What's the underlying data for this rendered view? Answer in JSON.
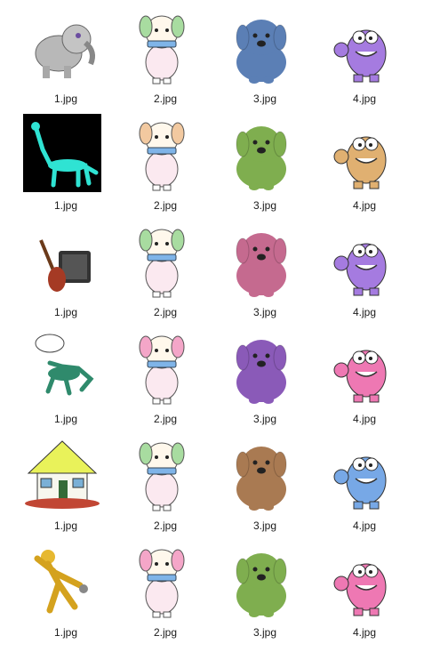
{
  "explorer": {
    "items": [
      {
        "label": "1.jpg",
        "icon": "elephant-thumbnail",
        "bg": "#ffffff"
      },
      {
        "label": "2.jpg",
        "icon": "dog-harmonica-green-thumbnail",
        "bg": "#ffffff"
      },
      {
        "label": "3.jpg",
        "icon": "puppy-blue-thumbnail",
        "bg": "#ffffff"
      },
      {
        "label": "4.jpg",
        "icon": "monster-purple-thumbnail",
        "bg": "#ffffff"
      },
      {
        "label": "1.jpg",
        "icon": "giraffe-thumbnail",
        "bg": "#000000"
      },
      {
        "label": "2.jpg",
        "icon": "dog-harmonica-orange-thumbnail",
        "bg": "#ffffff"
      },
      {
        "label": "3.jpg",
        "icon": "puppy-green-thumbnail",
        "bg": "#ffffff"
      },
      {
        "label": "4.jpg",
        "icon": "monster-orange-thumbnail",
        "bg": "#ffffff"
      },
      {
        "label": "1.jpg",
        "icon": "guitar-amp-thumbnail",
        "bg": "#ffffff"
      },
      {
        "label": "2.jpg",
        "icon": "dog-harmonica-green-thumbnail",
        "bg": "#ffffff"
      },
      {
        "label": "3.jpg",
        "icon": "puppy-pink-thumbnail",
        "bg": "#ffffff"
      },
      {
        "label": "4.jpg",
        "icon": "monster-purple-thumbnail",
        "bg": "#ffffff"
      },
      {
        "label": "1.jpg",
        "icon": "horse-thumbnail",
        "bg": "#ffffff"
      },
      {
        "label": "2.jpg",
        "icon": "dog-harmonica-pink-thumbnail",
        "bg": "#ffffff"
      },
      {
        "label": "3.jpg",
        "icon": "puppy-purple-thumbnail",
        "bg": "#ffffff"
      },
      {
        "label": "4.jpg",
        "icon": "monster-pink-thumbnail",
        "bg": "#ffffff"
      },
      {
        "label": "1.jpg",
        "icon": "house-thumbnail",
        "bg": "#ffffff"
      },
      {
        "label": "2.jpg",
        "icon": "dog-harmonica-green-thumbnail",
        "bg": "#ffffff"
      },
      {
        "label": "3.jpg",
        "icon": "puppy-brown-thumbnail",
        "bg": "#ffffff"
      },
      {
        "label": "4.jpg",
        "icon": "monster-blue-thumbnail",
        "bg": "#ffffff"
      },
      {
        "label": "1.jpg",
        "icon": "golden-figure-thumbnail",
        "bg": "#ffffff"
      },
      {
        "label": "2.jpg",
        "icon": "dog-harmonica-pink-thumbnail",
        "bg": "#ffffff"
      },
      {
        "label": "3.jpg",
        "icon": "puppy-green-thumbnail",
        "bg": "#ffffff"
      },
      {
        "label": "4.jpg",
        "icon": "monster-pink-thumbnail",
        "bg": "#ffffff"
      }
    ]
  },
  "colors": {
    "puppy_blue": "#5b7fb5",
    "puppy_green": "#7fae4f",
    "puppy_pink": "#c56a8f",
    "puppy_purple": "#8a5ab8",
    "puppy_brown": "#a97a52",
    "monster_purple": "#a57be0",
    "monster_orange": "#e0b071",
    "monster_pink": "#ee78b3",
    "monster_blue": "#77a8e6",
    "badge": "#2a8be0"
  }
}
